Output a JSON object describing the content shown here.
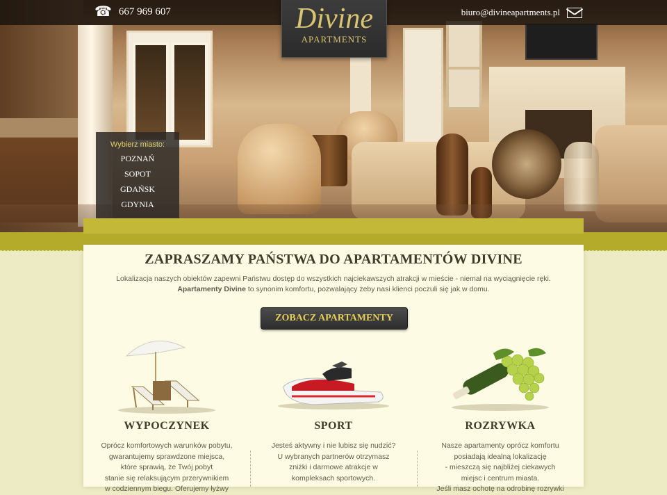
{
  "header": {
    "phone": "667 969 607",
    "phone_icon": "phone-icon",
    "email": "biuro@divineapartments.pl",
    "email_icon": "envelope-icon"
  },
  "logo": {
    "main": "Divine",
    "sub": "APARTMENTS"
  },
  "city_menu": {
    "label": "Wybierz miasto:",
    "items": [
      "POZNAŃ",
      "SOPOT",
      "GDAŃSK",
      "GDYNIA"
    ]
  },
  "intro": {
    "title": "ZAPRASZAMY PAŃSTWA DO APARTAMENTÓW DIVINE",
    "line1": "Lokalizacja naszych obiektów zapewni Państwu dostęp do wszystkich najciekawszych atrakcji w mieście - niemal na wyciągnięcie ręki.",
    "line2_bold": "Apartamenty Divine",
    "line2_rest": " to synonim komfortu, pozwalający żeby nasi klienci poczuli się jak w domu."
  },
  "cta": {
    "label": "ZOBACZ APARTAMENTY"
  },
  "features": [
    {
      "title": "WYPOCZYNEK",
      "lines": [
        "Oprócz komfortowych warunków pobytu,",
        "gwarantujemy sprawdzone miejsca,",
        "które sprawią, że Twój pobyt",
        "stanie się relaksującym przerywnikiem",
        "w codziennym biegu. Oferujemy łyżwy"
      ]
    },
    {
      "title": "SPORT",
      "lines": [
        "Jesteś aktywny i nie lubisz się nudzić?",
        "U wybranych partnerów otrzymasz",
        "zniżki i darmowe atrakcje w",
        "kompleksach sportowych."
      ]
    },
    {
      "title": "ROZRYWKA",
      "lines": [
        "Nasze apartamenty oprócz komfortu",
        "posiadają idealną lokalizację",
        "- mieszczą się najbliżej ciekawych",
        "miejsc i centrum miasta.",
        "Jeśli masz ochotę na odrobinę rozrywki"
      ]
    }
  ],
  "colors": {
    "accent_gold": "#e8cf57",
    "band_green": "#b5ab2b",
    "panel": "#fdfbe4"
  }
}
